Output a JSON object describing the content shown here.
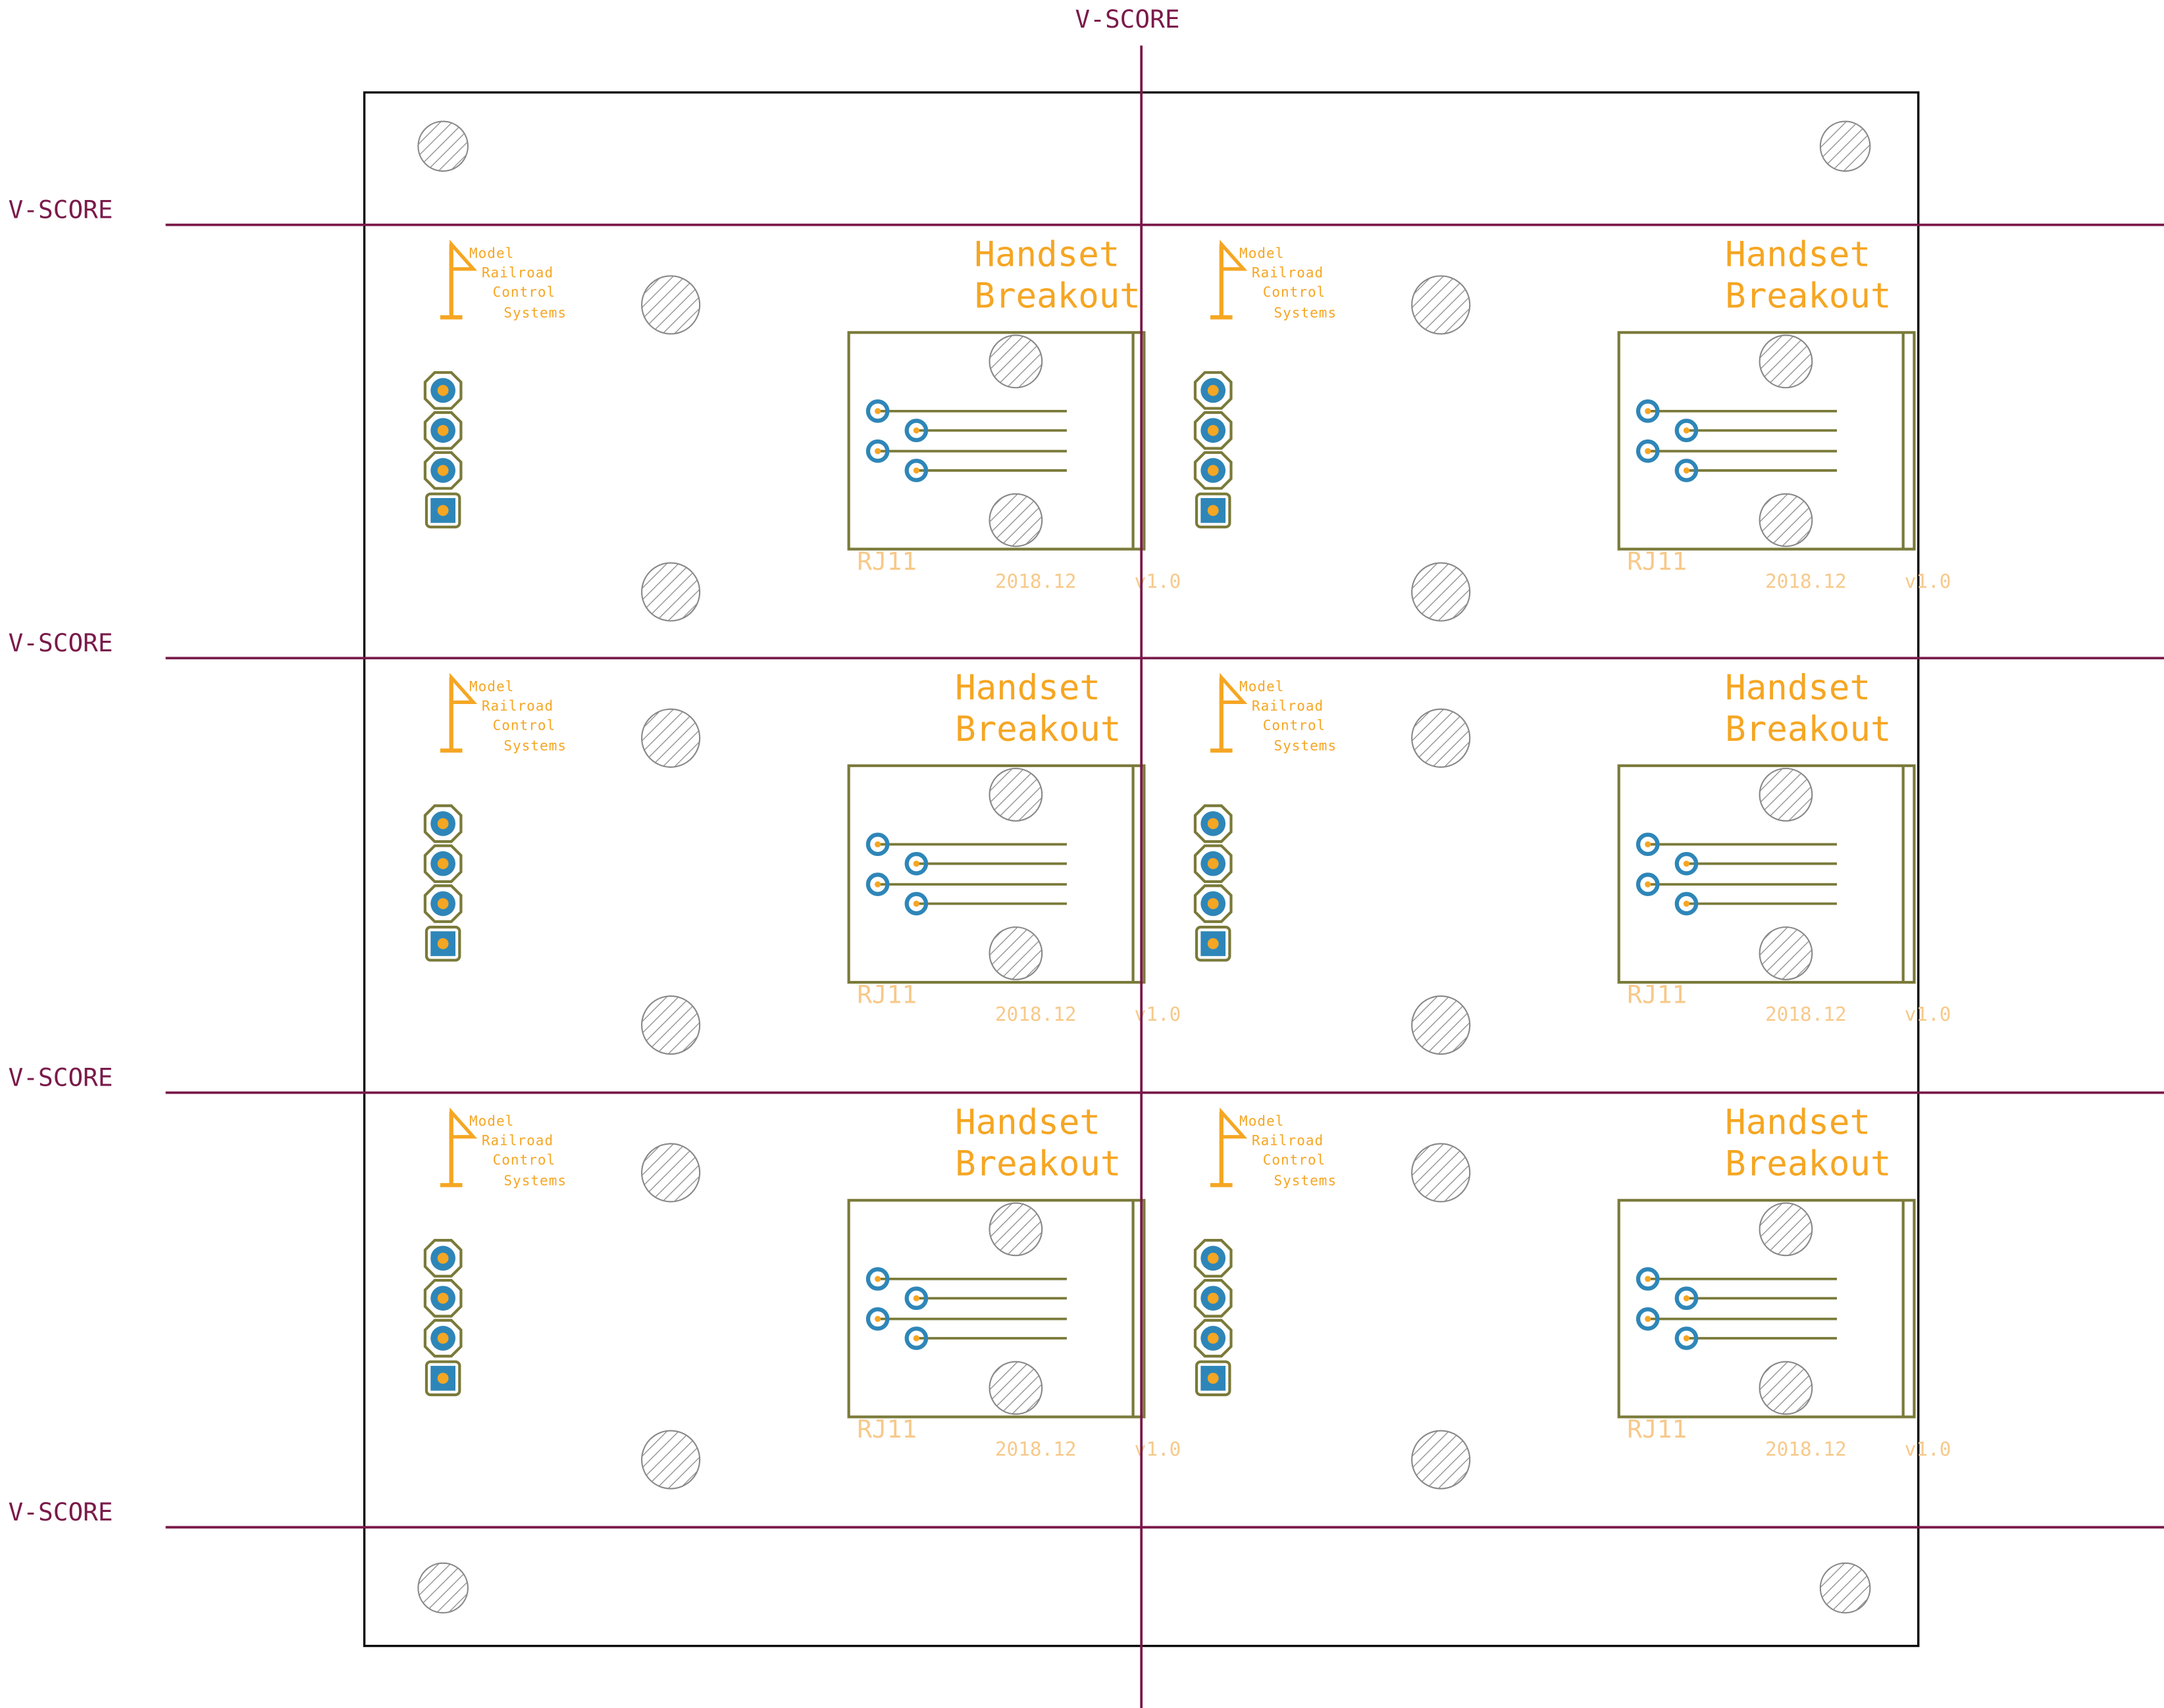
{
  "colors": {
    "vscore": "#7a1a4a",
    "outline": "#000000",
    "silk": "#f5a623",
    "silk_faint": "#f7c98a",
    "fab": "#7a7a3a",
    "pad": "#2e86b8",
    "drill": "#f5a623",
    "hole": "#888888"
  },
  "vscore_label": "V-SCORE",
  "board": {
    "title_line1": "Handset",
    "title_line2": "Breakout",
    "logo_lines": [
      "Model",
      "Railroad",
      "Control",
      "Systems"
    ],
    "connector_ref": "RJ11",
    "date": "2018.12",
    "version": "v1.0"
  }
}
